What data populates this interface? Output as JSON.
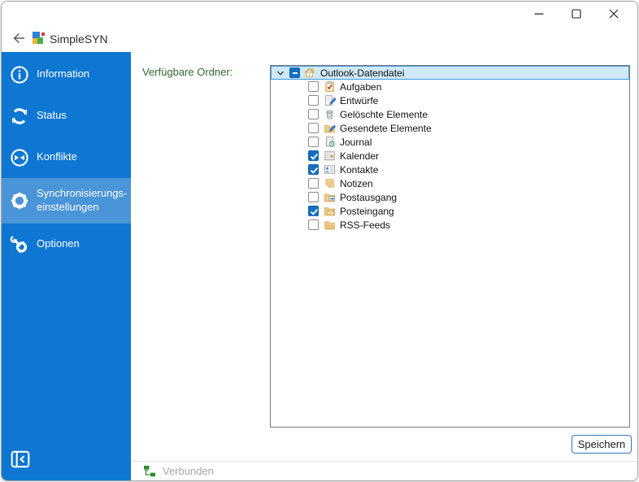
{
  "window": {
    "title": "SimpleSYN",
    "controls": [
      {
        "name": "minimize-button",
        "icon": "minimize-icon"
      },
      {
        "name": "maximize-button",
        "icon": "maximize-icon"
      },
      {
        "name": "close-button",
        "icon": "close-icon"
      }
    ],
    "back_icon": "back-arrow-icon",
    "logo_icon": "simplesyn-logo"
  },
  "sidebar": {
    "items": [
      {
        "label": "Information",
        "icon": "info-icon",
        "selected": false
      },
      {
        "label": "Status",
        "icon": "sync-icon",
        "selected": false
      },
      {
        "label": "Konflikte",
        "icon": "conflicts-icon",
        "selected": false
      },
      {
        "label": "Synchronisierungs-einstellungen",
        "icon": "gear-icon",
        "selected": true
      },
      {
        "label": "Optionen",
        "icon": "options-icon",
        "selected": false
      }
    ],
    "collapse_icon": "collapse-sidebar-icon",
    "colors": {
      "background": "#0e77d1",
      "selected": "#4a94d8"
    }
  },
  "main": {
    "folders_label": "Verfügbare Ordner:",
    "tree": {
      "root": {
        "label": "Outlook-Datendatei",
        "icon": "home-icon",
        "checkbox": "indeterminate",
        "expanded": true,
        "selected": true
      },
      "items": [
        {
          "label": "Aufgaben",
          "icon": "tasks-icon",
          "checked": false
        },
        {
          "label": "Entwürfe",
          "icon": "drafts-icon",
          "checked": false
        },
        {
          "label": "Gelöschte Elemente",
          "icon": "trash-icon",
          "checked": false
        },
        {
          "label": "Gesendete Elemente",
          "icon": "sent-icon",
          "checked": false
        },
        {
          "label": "Journal",
          "icon": "journal-icon",
          "checked": false
        },
        {
          "label": "Kalender",
          "icon": "calendar-icon",
          "checked": true
        },
        {
          "label": "Kontakte",
          "icon": "contacts-icon",
          "checked": true
        },
        {
          "label": "Notizen",
          "icon": "notes-icon",
          "checked": false
        },
        {
          "label": "Postausgang",
          "icon": "outbox-icon",
          "checked": false
        },
        {
          "label": "Posteingang",
          "icon": "inbox-icon",
          "checked": true
        },
        {
          "label": "RSS-Feeds",
          "icon": "folder-icon",
          "checked": false
        }
      ]
    },
    "save_button": "Speichern"
  },
  "statusbar": {
    "label": "Verbunden",
    "icon": "network-icon"
  },
  "colors": {
    "sidebar_blue": "#0e77d1",
    "sidebar_selected": "#4a94d8",
    "tree_selection_fill": "#cfe9f8",
    "tree_selection_border": "#3f9ce2",
    "checkbox_checked": "#1470bf",
    "label_green": "#2d6a2d",
    "status_green": "#217a21",
    "save_border_blue": "#3376bd"
  }
}
